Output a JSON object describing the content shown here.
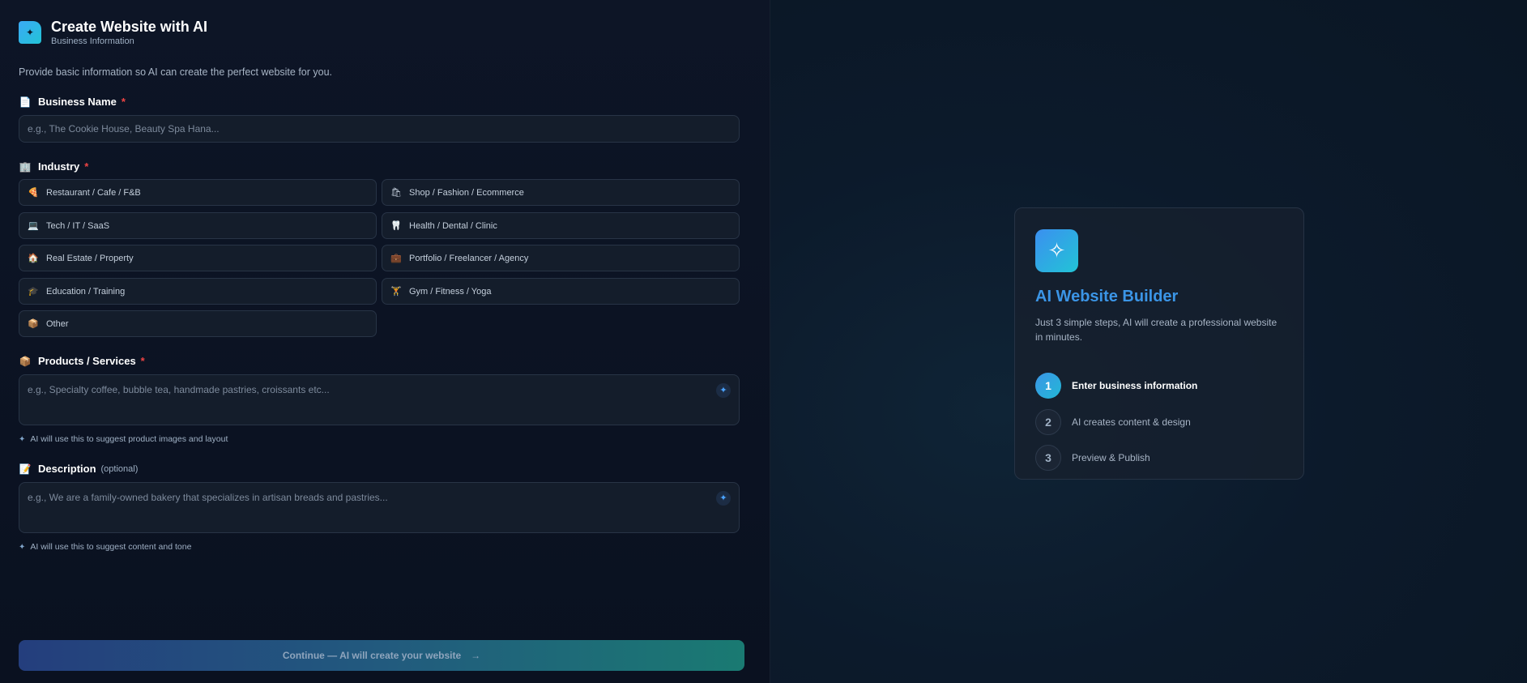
{
  "header": {
    "title": "Create Website with AI",
    "subtitle": "Business Information",
    "logo_icon": "document-sparkle-icon"
  },
  "intro": "Provide basic information so AI can create the perfect website for you.",
  "fields": {
    "business_name": {
      "label": "Business Name",
      "required_mark": "*",
      "icon": "📄",
      "placeholder": "e.g., The Cookie House, Beauty Spa Hana..."
    },
    "industry": {
      "label": "Industry",
      "required_mark": "*",
      "icon": "🏢",
      "options": [
        {
          "icon": "🍕",
          "label": "Restaurant / Cafe / F&B"
        },
        {
          "icon": "🛍",
          "label": "Shop / Fashion / Ecommerce"
        },
        {
          "icon": "💻",
          "label": "Tech / IT / SaaS"
        },
        {
          "icon": "🦷",
          "label": "Health / Dental / Clinic"
        },
        {
          "icon": "🏠",
          "label": "Real Estate / Property"
        },
        {
          "icon": "💼",
          "label": "Portfolio / Freelancer / Agency"
        },
        {
          "icon": "🎓",
          "label": "Education / Training"
        },
        {
          "icon": "🏋",
          "label": "Gym / Fitness / Yoga"
        },
        {
          "icon": "📦",
          "label": "Other"
        }
      ]
    },
    "products": {
      "label": "Products / Services",
      "required_mark": "*",
      "icon": "📦",
      "placeholder": "e.g., Specialty coffee, bubble tea, handmade pastries, croissants etc...",
      "hint": "AI will use this to suggest product images and layout"
    },
    "description": {
      "label": "Description",
      "optional_text": "(optional)",
      "icon": "📝",
      "placeholder": "e.g., We are a family-owned bakery that specializes in artisan breads and pastries...",
      "hint": "AI will use this to suggest content and tone"
    }
  },
  "continue_button": {
    "label": "Continue — AI will create your website",
    "arrow": "→"
  },
  "card": {
    "icon": "sparkles-icon",
    "title": "AI Website Builder",
    "description": "Just 3 simple steps, AI will create a professional website in minutes.",
    "steps": [
      {
        "num": "1",
        "label": "Enter business information"
      },
      {
        "num": "2",
        "label": "AI creates content & design"
      },
      {
        "num": "3",
        "label": "Preview & Publish"
      }
    ]
  },
  "colors": {
    "accent": "#3b95e6",
    "required": "#ef4444",
    "background": "#0b1220"
  }
}
